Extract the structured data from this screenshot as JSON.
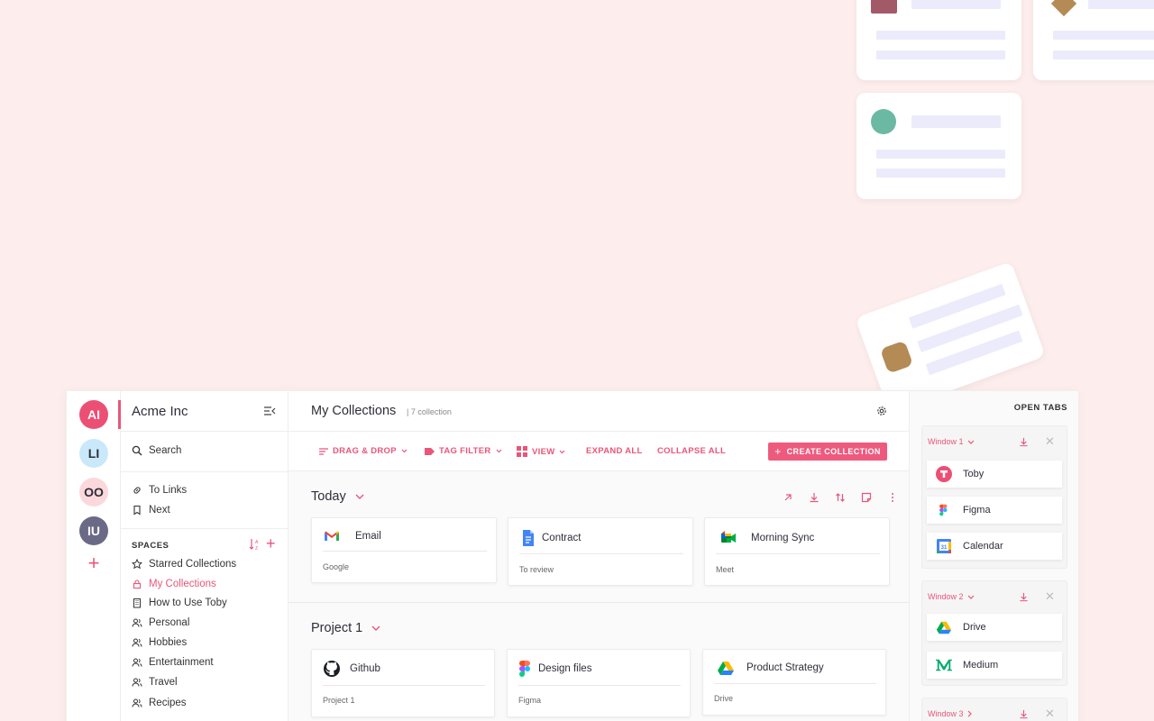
{
  "workspace": {
    "name": "Acme Inc"
  },
  "rail": {
    "avatars": [
      {
        "initials": "AI",
        "bg": "#ec4f74",
        "fg": "#ffffff"
      },
      {
        "initials": "LI",
        "bg": "#c9e9fb",
        "fg": "#2e2e3a"
      },
      {
        "initials": "OO",
        "bg": "#fbd8dc",
        "fg": "#2e2e3a"
      },
      {
        "initials": "IU",
        "bg": "#6b6a86",
        "fg": "#ffffff"
      }
    ]
  },
  "sidebar": {
    "search_label": "Search",
    "links": [
      {
        "label": "To Links",
        "icon": "link-icon"
      },
      {
        "label": "Next",
        "icon": "bookmark-icon"
      }
    ],
    "spaces_heading": "SPACES",
    "spaces": [
      {
        "label": "Starred Collections",
        "icon": "star-icon",
        "active": false
      },
      {
        "label": "My Collections",
        "icon": "lock-icon",
        "active": true
      },
      {
        "label": "How to Use Toby",
        "icon": "building-icon",
        "active": false
      },
      {
        "label": "Personal",
        "icon": "users-icon",
        "active": false
      },
      {
        "label": "Hobbies",
        "icon": "users-icon",
        "active": false
      },
      {
        "label": "Entertainment",
        "icon": "users-icon",
        "active": false
      },
      {
        "label": "Travel",
        "icon": "users-icon",
        "active": false
      },
      {
        "label": "Recipes",
        "icon": "users-icon",
        "active": false
      }
    ]
  },
  "main": {
    "title": "My Collections",
    "count": "| 7 collection",
    "toolbar": {
      "drag_drop": "DRAG & DROP",
      "tag_filter": "TAG FILTER",
      "view": "VIEW",
      "expand_all": "EXPAND ALL",
      "collapse_all": "COLLAPSE ALL",
      "create": "CREATE COLLECTION"
    },
    "collections": [
      {
        "title": "Today",
        "cards": [
          {
            "name": "Email",
            "sub": "Google",
            "icon": "gmail-icon"
          },
          {
            "name": "Contract",
            "sub": "To review",
            "icon": "docs-icon"
          },
          {
            "name": "Morning Sync",
            "sub": "Meet",
            "icon": "meet-icon"
          }
        ]
      },
      {
        "title": "Project 1",
        "cards": [
          {
            "name": "Github",
            "sub": "Project 1",
            "icon": "github-icon"
          },
          {
            "name": "Design files",
            "sub": "Figma",
            "icon": "figma-icon"
          },
          {
            "name": "Product Strategy",
            "sub": "Drive",
            "icon": "drive-icon"
          }
        ]
      }
    ]
  },
  "open_tabs": {
    "heading": "OPEN TABS",
    "windows": [
      {
        "label": "Window 1",
        "tabs": [
          {
            "name": "Toby",
            "icon": "toby-icon"
          },
          {
            "name": "Figma",
            "icon": "figma-icon"
          },
          {
            "name": "Calendar",
            "icon": "calendar-icon"
          }
        ]
      },
      {
        "label": "Window 2",
        "tabs": [
          {
            "name": "Drive",
            "icon": "drive-icon"
          },
          {
            "name": "Medium",
            "icon": "medium-icon"
          }
        ]
      },
      {
        "label": "Window 3",
        "tabs": []
      }
    ]
  },
  "colors": {
    "accent": "#e9567a",
    "background": "#fdeeed"
  }
}
